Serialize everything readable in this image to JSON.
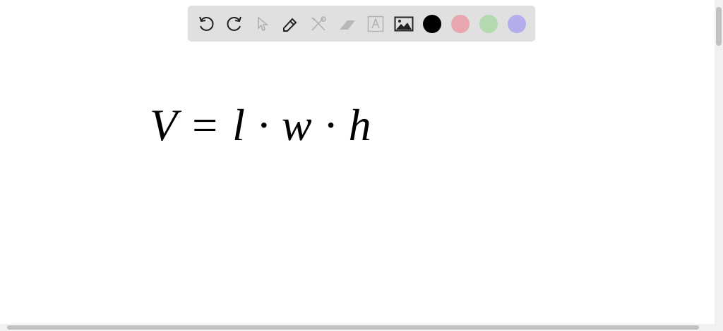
{
  "toolbar": {
    "tools": [
      "undo-icon",
      "redo-icon",
      "select-icon",
      "pen-icon",
      "tools-icon",
      "eraser-icon",
      "text-icon",
      "image-icon"
    ],
    "colors": {
      "black": "#000000",
      "pink": "#e8a6ae",
      "green": "#b4d8b0",
      "purple": "#b3aee9"
    }
  },
  "canvas": {
    "handwriting": "V = l · w · h"
  }
}
